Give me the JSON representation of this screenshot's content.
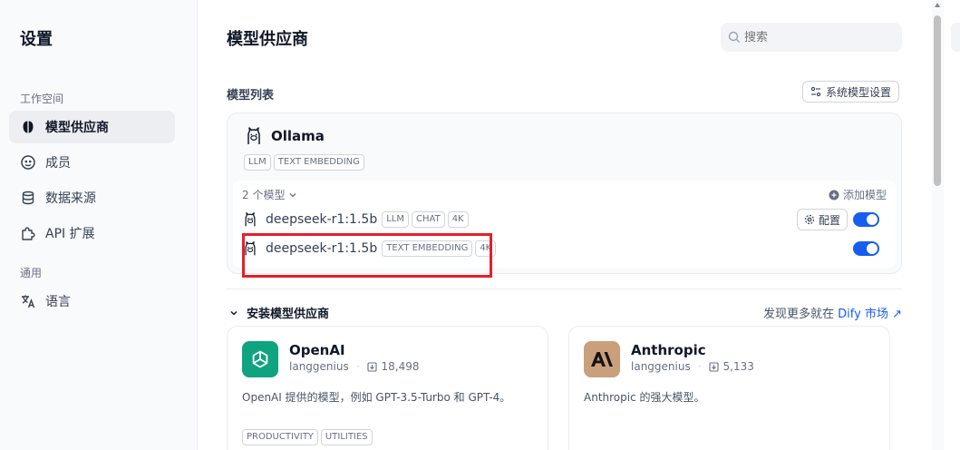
{
  "sidebar": {
    "title": "设置",
    "workspace_label": "工作空间",
    "general_label": "通用",
    "items": [
      {
        "label": "模型供应商",
        "icon": "brain-icon"
      },
      {
        "label": "成员",
        "icon": "members-icon"
      },
      {
        "label": "数据来源",
        "icon": "database-icon"
      },
      {
        "label": "API 扩展",
        "icon": "puzzle-icon"
      },
      {
        "label": "语言",
        "icon": "translate-icon"
      }
    ]
  },
  "header": {
    "title": "模型供应商",
    "search_placeholder": "搜索"
  },
  "model_list": {
    "label": "模型列表",
    "system_settings_label": "系统模型设置"
  },
  "provider": {
    "name": "Ollama",
    "tags": [
      "LLM",
      "TEXT EMBEDDING"
    ],
    "model_count": "2 个模型",
    "add_model": "添加模型",
    "models": [
      {
        "name": "deepseek-r1:1.5b",
        "tags": [
          "LLM",
          "CHAT",
          "4K"
        ],
        "config_label": "配置",
        "enabled": true
      },
      {
        "name": "deepseek-r1:1.5b",
        "tags": [
          "TEXT EMBEDDING",
          "4K"
        ],
        "enabled": true
      }
    ]
  },
  "install": {
    "label": "安装模型供应商",
    "discover_prefix": "发现更多就在",
    "discover_link": "Dify 市场",
    "plugins": [
      {
        "name": "OpenAI",
        "author": "langgenius",
        "installs": "18,498",
        "description": "OpenAI 提供的模型，例如 GPT-3.5-Turbo 和 GPT-4。",
        "tags": [
          "PRODUCTIVITY",
          "UTILITIES"
        ],
        "logo_color": "#10a37f"
      },
      {
        "name": "Anthropic",
        "author": "langgenius",
        "installs": "5,133",
        "description": "Anthropic 的强大模型。",
        "tags": [],
        "logo_color": "#ca9f7b"
      }
    ]
  },
  "colors": {
    "accent": "#155eef",
    "highlight": "#e5202a"
  }
}
